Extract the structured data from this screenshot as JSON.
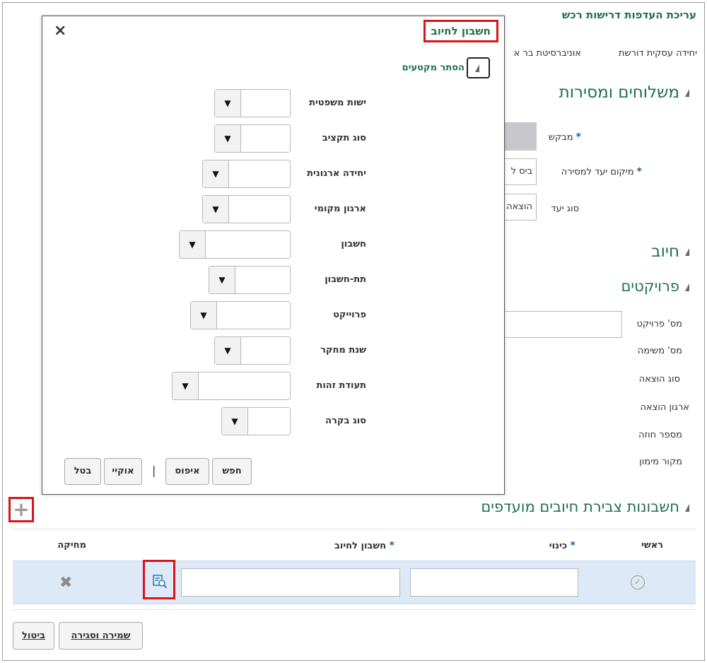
{
  "page": {
    "title": "עריכת העדפות דרישות רכש",
    "business_unit_label": "יחידה עסקית דורשת",
    "business_unit_value": "אוניברסיטת בר א"
  },
  "sections": {
    "delivery": "משלוחים ומסירות",
    "billing": "חיוב",
    "projects": "פרויקטים",
    "charge_accounts": "חשבונות צבירת חיובים מועדפים"
  },
  "delivery": {
    "requester_label": "מבקש",
    "deliver_to_label": "מיקום יעד למסירה",
    "deliver_to_value": "ביס ל",
    "dest_type_label": "סוג יעד",
    "dest_type_value": "הוצאה"
  },
  "projects": {
    "labels": [
      "מס' פרויקט",
      "מס' משימה",
      "סוג הוצאה",
      "ארגון הוצאה",
      "מספר חוזה",
      "מקור מימון"
    ]
  },
  "modal": {
    "title": "חשבון לחיוב",
    "close_icon": "×",
    "hide_segments": "הסתר מקטעים",
    "segments": [
      "ישות משפטית",
      "סוג תקציב",
      "יחידה ארגונית",
      "ארגון מקומי",
      "חשבון",
      "תת-חשבון",
      "פרוייקט",
      "שנת מחקר",
      "תעודת זהות",
      "סוג בקרה"
    ],
    "dropdown_glyph": "▼",
    "buttons": {
      "search": "חפש",
      "reset": "איפוס",
      "ok": "אוקיי",
      "cancel": "בטל"
    },
    "separator": "|"
  },
  "table": {
    "add_icon": "+",
    "headers": {
      "primary": "ראשי",
      "nickname": "כינוי",
      "charge_account": "חשבון לחיוב",
      "delete": "מחיקה"
    },
    "required_mark": "*",
    "delete_icon": "✖",
    "check_icon": "✓"
  },
  "footer": {
    "save_close": "שמירה וסגירה",
    "cancel": "ביטול"
  },
  "colors": {
    "accent_green": "#1f6f4e",
    "highlight_red": "#d9141a",
    "row_blue": "#dde9f6"
  }
}
